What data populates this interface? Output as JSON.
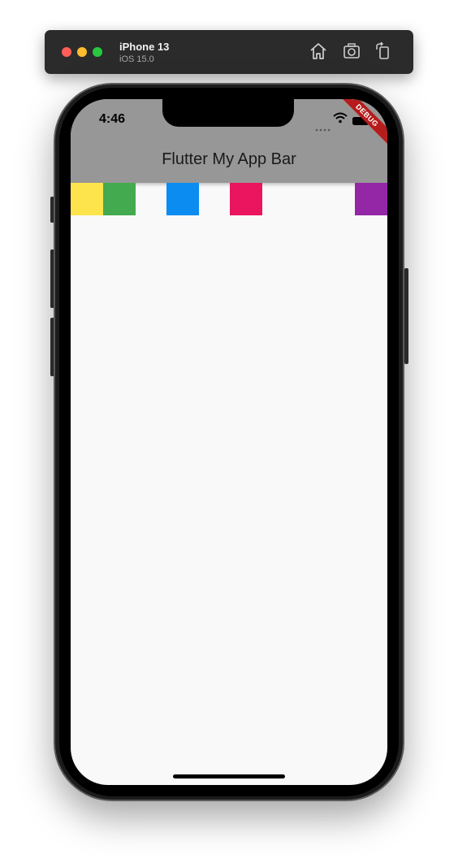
{
  "simulator": {
    "device_name": "iPhone 13",
    "os_version": "iOS 15.0",
    "icons": [
      "home-icon",
      "screenshot-icon",
      "rotate-icon"
    ]
  },
  "status_bar": {
    "time": "4:46"
  },
  "app_bar": {
    "title": "Flutter My App Bar",
    "background": "#979797"
  },
  "debug_banner": {
    "label": "DEBUG",
    "color": "#b71c1c"
  },
  "color_blocks": [
    {
      "name": "yellow",
      "color": "#fee44c"
    },
    {
      "name": "green",
      "color": "#43aa50"
    },
    {
      "name": "blue",
      "color": "#0a8cf0"
    },
    {
      "name": "pink",
      "color": "#ea145f"
    },
    {
      "name": "purple",
      "color": "#9327a6"
    }
  ],
  "screen_background": "#f9f9f9"
}
